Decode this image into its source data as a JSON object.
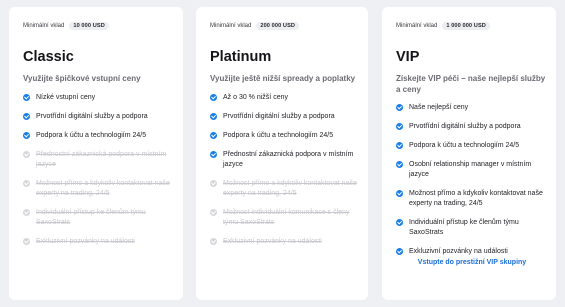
{
  "cards": [
    {
      "min_label": "Minimální vklad",
      "min_value": "10 000 USD",
      "title": "Classic",
      "subtitle": "Využijte špičkové vstupní ceny",
      "features": [
        {
          "text": "Nízké vstupní ceny",
          "enabled": true
        },
        {
          "text": "Prvotřídní digitální služby a podpora",
          "enabled": true
        },
        {
          "text": "Podpora k účtu a technologiím 24/5",
          "enabled": true
        },
        {
          "text": "Přednostní zákaznická podpora v místním jazyce",
          "enabled": false
        },
        {
          "text": "Možnost přímo a kdykoliv kontaktovat naše experty na trading, 24/5",
          "enabled": false
        },
        {
          "text": "Individuální přístup ke členům týmu SaxoStrats",
          "enabled": false
        },
        {
          "text": "Exkluzivní pozvánky na události",
          "enabled": false
        }
      ]
    },
    {
      "min_label": "Minimální vklad",
      "min_value": "200 000 USD",
      "title": "Platinum",
      "subtitle": "Využijte ještě nižší spready a poplatky",
      "features": [
        {
          "text": "Až o 30 % nižší ceny",
          "enabled": true
        },
        {
          "text": "Prvotřídní digitální služby a podpora",
          "enabled": true
        },
        {
          "text": "Podpora k účtu a technologiím 24/5",
          "enabled": true
        },
        {
          "text": "Přednostní zákaznická podpora v místním jazyce",
          "enabled": true
        },
        {
          "text": "Možnost přímo a kdykoliv kontaktovat naše experty na trading, 24/5",
          "enabled": false
        },
        {
          "text": "Možnost individuální komunikace s členy týmu SaxoStrats",
          "enabled": false
        },
        {
          "text": "Exkluzivní pozvánky na události",
          "enabled": false
        }
      ]
    },
    {
      "min_label": "Minimální vklad",
      "min_value": "1 000 000 USD",
      "title": "VIP",
      "subtitle": "Získejte VIP péči – naše nejlepší služby a ceny",
      "features": [
        {
          "text": "Naše nejlepší ceny",
          "enabled": true
        },
        {
          "text": "Prvotřídní digitální služby a podpora",
          "enabled": true
        },
        {
          "text": "Podpora k účtu a technologiím 24/5",
          "enabled": true
        },
        {
          "text": "Osobní relationship manager v místním jazyce",
          "enabled": true
        },
        {
          "text": "Možnost přímo a kdykoliv kontaktovat naše experty na trading, 24/5",
          "enabled": true
        },
        {
          "text": "Individuální přístup ke členům týmu SaxoStrats",
          "enabled": true
        },
        {
          "text": "Exkluzivní pozvánky na události",
          "enabled": true
        }
      ],
      "link": "Vstupte do prestižní VIP skupiny"
    }
  ],
  "colors": {
    "accent": "#1a7fe6",
    "link": "#1a6ed8",
    "disabled": "#c8c9ce",
    "background": "#eef0f4"
  }
}
